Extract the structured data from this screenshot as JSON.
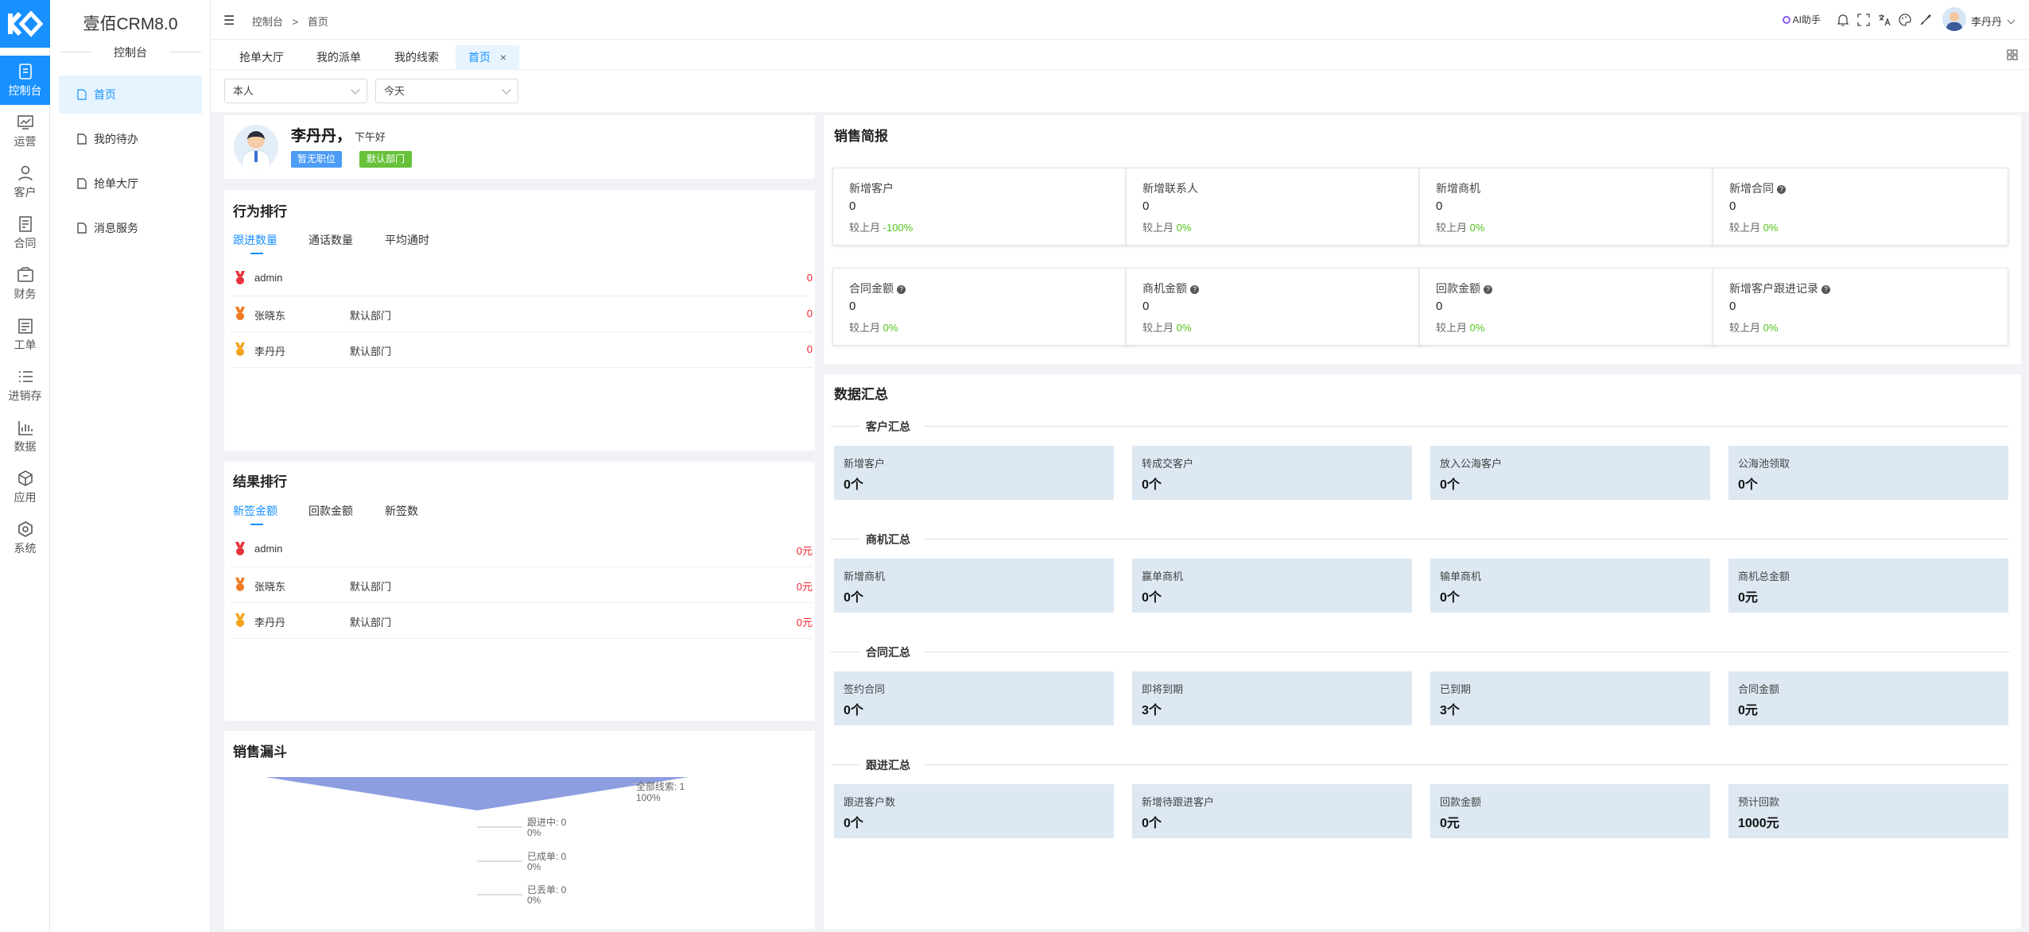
{
  "app": {
    "brand": "壹佰CRM8.0",
    "submenu_title": "控制台"
  },
  "rail": [
    {
      "label": "控制台",
      "icon": "dashboard-icon"
    },
    {
      "label": "运营",
      "icon": "monitor-chart-icon"
    },
    {
      "label": "客户",
      "icon": "user-icon"
    },
    {
      "label": "合同",
      "icon": "contract-icon"
    },
    {
      "label": "财务",
      "icon": "wallet-icon"
    },
    {
      "label": "工单",
      "icon": "ticket-icon"
    },
    {
      "label": "进销存",
      "icon": "list-icon"
    },
    {
      "label": "数据",
      "icon": "bar-chart-icon"
    },
    {
      "label": "应用",
      "icon": "cube-icon"
    },
    {
      "label": "系统",
      "icon": "hexagon-icon"
    }
  ],
  "submenu": [
    {
      "label": "首页"
    },
    {
      "label": "我的待办"
    },
    {
      "label": "抢单大厅"
    },
    {
      "label": "消息服务"
    }
  ],
  "header": {
    "breadcrumb_root": "控制台",
    "breadcrumb_sep": ">",
    "breadcrumb_current": "首页",
    "ai_label": "AI助手",
    "username": "李丹丹"
  },
  "tabs": [
    {
      "label": "抢单大厅"
    },
    {
      "label": "我的派单"
    },
    {
      "label": "我的线索"
    },
    {
      "label": "首页",
      "close": "×"
    }
  ],
  "filters": {
    "scope": "本人",
    "period": "今天"
  },
  "profile": {
    "name": "李丹丹，",
    "greeting": "下午好",
    "position_badge": "暂无职位",
    "dept_badge": "默认部门"
  },
  "behavior_rank": {
    "title": "行为排行",
    "tabs": [
      "跟进数量",
      "通话数量",
      "平均通时"
    ],
    "rows": [
      {
        "name": "admin",
        "dept": "",
        "value": "0"
      },
      {
        "name": "张晓东",
        "dept": "默认部门",
        "value": "0"
      },
      {
        "name": "李丹丹",
        "dept": "默认部门",
        "value": "0"
      }
    ]
  },
  "result_rank": {
    "title": "结果排行",
    "tabs": [
      "新签金额",
      "回款金额",
      "新签数"
    ],
    "rows": [
      {
        "name": "admin",
        "dept": "",
        "value": "0元"
      },
      {
        "name": "张晓东",
        "dept": "默认部门",
        "value": "0元"
      },
      {
        "name": "李丹丹",
        "dept": "默认部门",
        "value": "0元"
      }
    ]
  },
  "funnel": {
    "title": "销售漏斗",
    "stages": [
      {
        "label": "全部线索: 1",
        "pct": "100%",
        "fraction": 1.0
      },
      {
        "label": "跟进中: 0",
        "pct": "0%",
        "fraction": 0
      },
      {
        "label": "已成单: 0",
        "pct": "0%",
        "fraction": 0
      },
      {
        "label": "已丢单: 0",
        "pct": "0%",
        "fraction": 0
      }
    ],
    "color": "#8c9de0"
  },
  "sales_brief": {
    "title": "销售简报",
    "compare_prefix": "较上月",
    "cards": [
      {
        "label": "新增客户",
        "value": "0",
        "change": "-100%",
        "help": false
      },
      {
        "label": "新增联系人",
        "value": "0",
        "change": "0%",
        "help": false
      },
      {
        "label": "新增商机",
        "value": "0",
        "change": "0%",
        "help": false
      },
      {
        "label": "新增合同",
        "value": "0",
        "change": "0%",
        "help": true
      },
      {
        "label": "合同金额",
        "value": "0",
        "change": "0%",
        "help": true
      },
      {
        "label": "商机金额",
        "value": "0",
        "change": "0%",
        "help": true
      },
      {
        "label": "回款金额",
        "value": "0",
        "change": "0%",
        "help": true
      },
      {
        "label": "新增客户跟进记录",
        "value": "0",
        "change": "0%",
        "help": true
      }
    ]
  },
  "data_summary": {
    "title": "数据汇总",
    "sections": [
      {
        "title": "客户汇总",
        "tiles": [
          {
            "label": "新增客户",
            "value": "0个"
          },
          {
            "label": "转成交客户",
            "value": "0个"
          },
          {
            "label": "放入公海客户",
            "value": "0个"
          },
          {
            "label": "公海池领取",
            "value": "0个"
          }
        ]
      },
      {
        "title": "商机汇总",
        "tiles": [
          {
            "label": "新增商机",
            "value": "0个"
          },
          {
            "label": "赢单商机",
            "value": "0个"
          },
          {
            "label": "输单商机",
            "value": "0个"
          },
          {
            "label": "商机总金额",
            "value": "0元"
          }
        ]
      },
      {
        "title": "合同汇总",
        "tiles": [
          {
            "label": "签约合同",
            "value": "0个"
          },
          {
            "label": "即将到期",
            "value": "3个"
          },
          {
            "label": "已到期",
            "value": "3个"
          },
          {
            "label": "合同金额",
            "value": "0元"
          }
        ]
      },
      {
        "title": "跟进汇总",
        "tiles": [
          {
            "label": "跟进客户数",
            "value": "0个"
          },
          {
            "label": "新增待跟进客户",
            "value": "0个"
          },
          {
            "label": "回款金额",
            "value": "0元"
          },
          {
            "label": "预计回款",
            "value": "1000元"
          }
        ]
      }
    ]
  },
  "colors": {
    "accent": "#1890ff",
    "rank_value": "#f5222d",
    "change_up": "#52c41a",
    "badge_blue": "#4c9cf6",
    "badge_green": "#67c23a",
    "tile_bg": "#dde8f3"
  }
}
